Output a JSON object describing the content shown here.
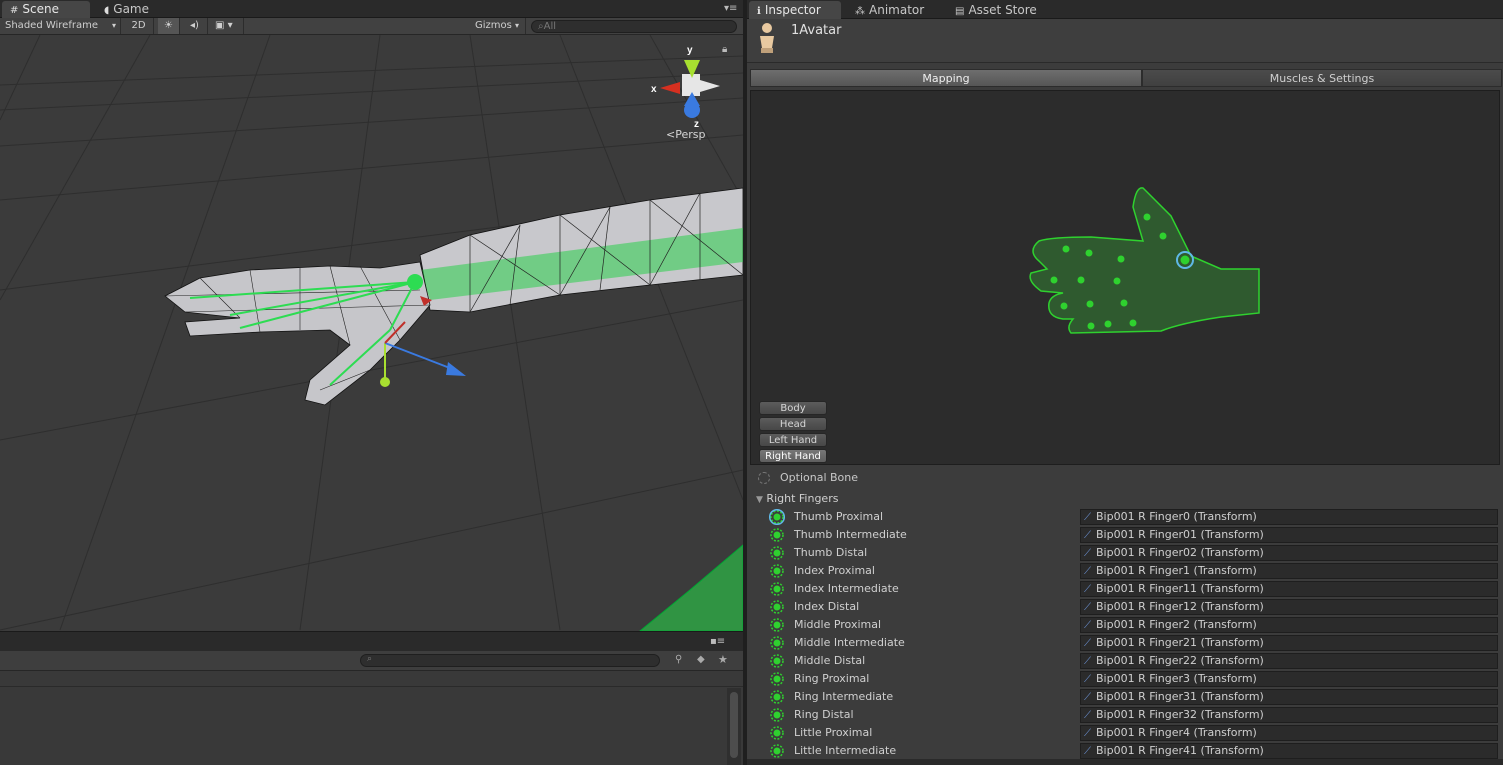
{
  "scene": {
    "tabs": [
      {
        "label": "Scene",
        "icon": "scene-grid-icon"
      },
      {
        "label": "Game",
        "icon": "pacman-icon"
      }
    ],
    "toolbar": {
      "shading": "Shaded Wireframe",
      "mode_2d": "2D",
      "gizmos": "Gizmos",
      "search_placeholder": "All"
    },
    "gizmo": {
      "axis_y": "y",
      "axis_x": "x",
      "axis_z": "z",
      "projection": "Persp"
    }
  },
  "inspector": {
    "tabs": [
      {
        "label": "Inspector",
        "icon": "info-icon"
      },
      {
        "label": "Animator",
        "icon": "animator-icon"
      },
      {
        "label": "Asset Store",
        "icon": "store-icon"
      }
    ],
    "object_name": "1Avatar",
    "map_tabs": {
      "mapping": "Mapping",
      "muscles": "Muscles & Settings"
    },
    "view_buttons": [
      "Body",
      "Head",
      "Left Hand",
      "Right Hand"
    ],
    "selected_view": "Right Hand",
    "optional_label": "Optional Bone",
    "group_label": "Right Fingers",
    "bones": [
      {
        "name": "Thumb Proximal",
        "transform": "Bip001 R Finger0 (Transform)",
        "selected": true
      },
      {
        "name": "Thumb Intermediate",
        "transform": "Bip001 R Finger01 (Transform)"
      },
      {
        "name": "Thumb Distal",
        "transform": "Bip001 R Finger02 (Transform)"
      },
      {
        "name": "Index Proximal",
        "transform": "Bip001 R Finger1 (Transform)"
      },
      {
        "name": "Index Intermediate",
        "transform": "Bip001 R Finger11 (Transform)"
      },
      {
        "name": "Index Distal",
        "transform": "Bip001 R Finger12 (Transform)"
      },
      {
        "name": "Middle Proximal",
        "transform": "Bip001 R Finger2 (Transform)"
      },
      {
        "name": "Middle Intermediate",
        "transform": "Bip001 R Finger21 (Transform)"
      },
      {
        "name": "Middle Distal",
        "transform": "Bip001 R Finger22 (Transform)"
      },
      {
        "name": "Ring Proximal",
        "transform": "Bip001 R Finger3 (Transform)"
      },
      {
        "name": "Ring Intermediate",
        "transform": "Bip001 R Finger31 (Transform)"
      },
      {
        "name": "Ring Distal",
        "transform": "Bip001 R Finger32 (Transform)"
      },
      {
        "name": "Little Proximal",
        "transform": "Bip001 R Finger4 (Transform)"
      },
      {
        "name": "Little Intermediate",
        "transform": "Bip001 R Finger41 (Transform)"
      }
    ],
    "colors": {
      "bone_green": "#2fd12f",
      "selected_ring": "#5fb8e6",
      "hand_fill": "#2f5a2f"
    }
  }
}
